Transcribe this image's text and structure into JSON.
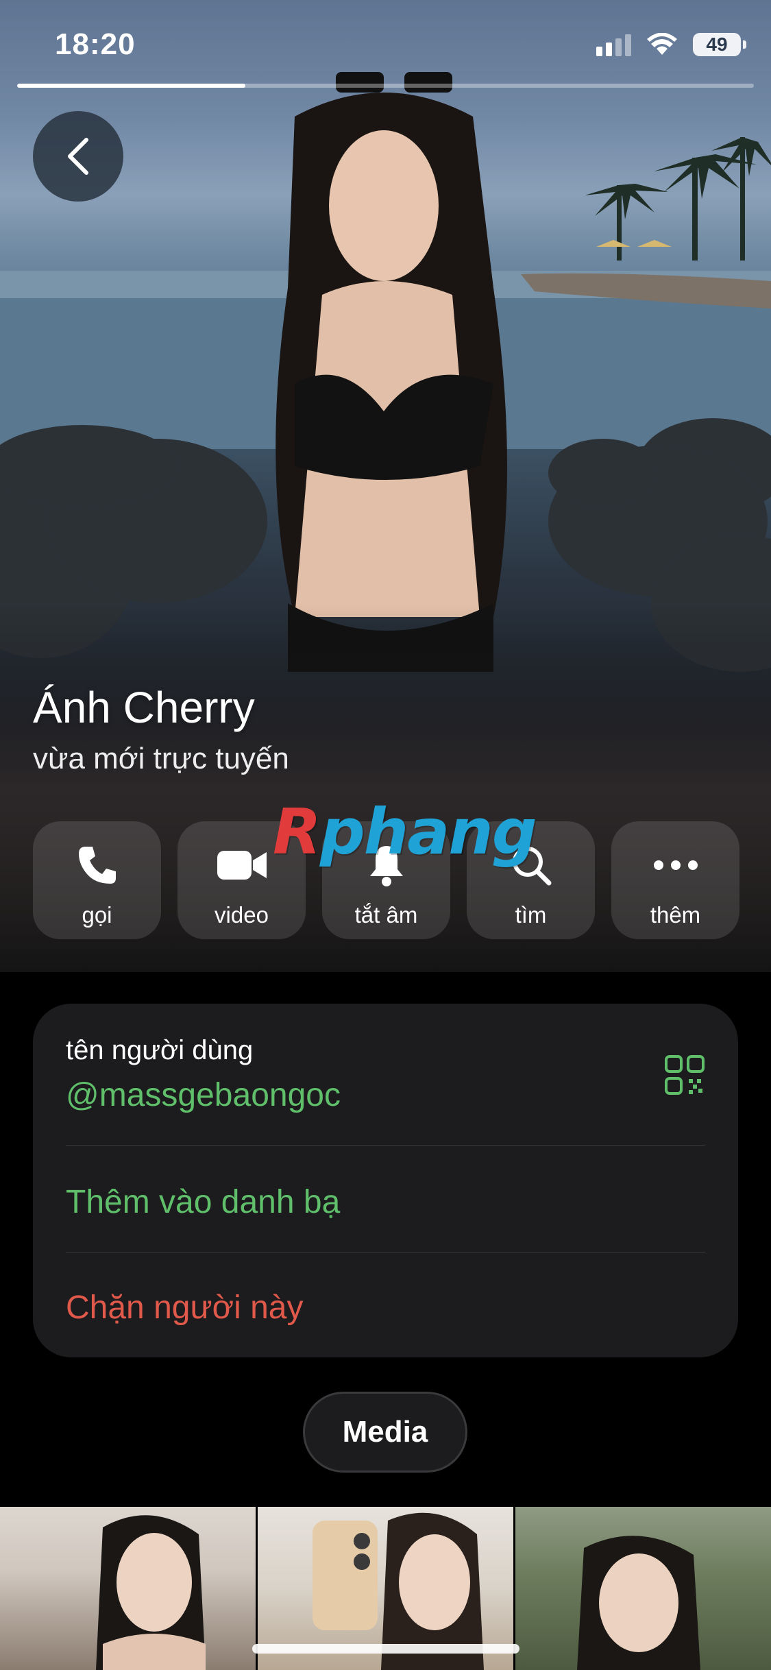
{
  "status_bar": {
    "time": "18:20",
    "battery": "49"
  },
  "story": {
    "progress": 0.31
  },
  "icons": {
    "back": "chevron-left-icon",
    "call": "phone-icon",
    "video": "video-camera-icon",
    "mute": "bell-icon",
    "search": "search-icon",
    "more": "ellipsis-icon",
    "qr": "qr-code-icon"
  },
  "profile": {
    "name": "Ánh Cherry",
    "status": "vừa mới trực tuyến"
  },
  "watermark": {
    "first": "R",
    "rest": "phang"
  },
  "actions": [
    {
      "label": "gọi"
    },
    {
      "label": "video"
    },
    {
      "label": "tắt âm"
    },
    {
      "label": "tìm"
    },
    {
      "label": "thêm"
    }
  ],
  "info": {
    "username_label": "tên người dùng",
    "username": "@massgebaongoc",
    "add_contact": "Thêm vào danh bạ",
    "block": "Chặn người này"
  },
  "media": {
    "tab_label": "Media"
  },
  "colors": {
    "accent_green": "#5fbf6a",
    "danger_red": "#e0594b",
    "card_bg": "#1c1c1e"
  }
}
